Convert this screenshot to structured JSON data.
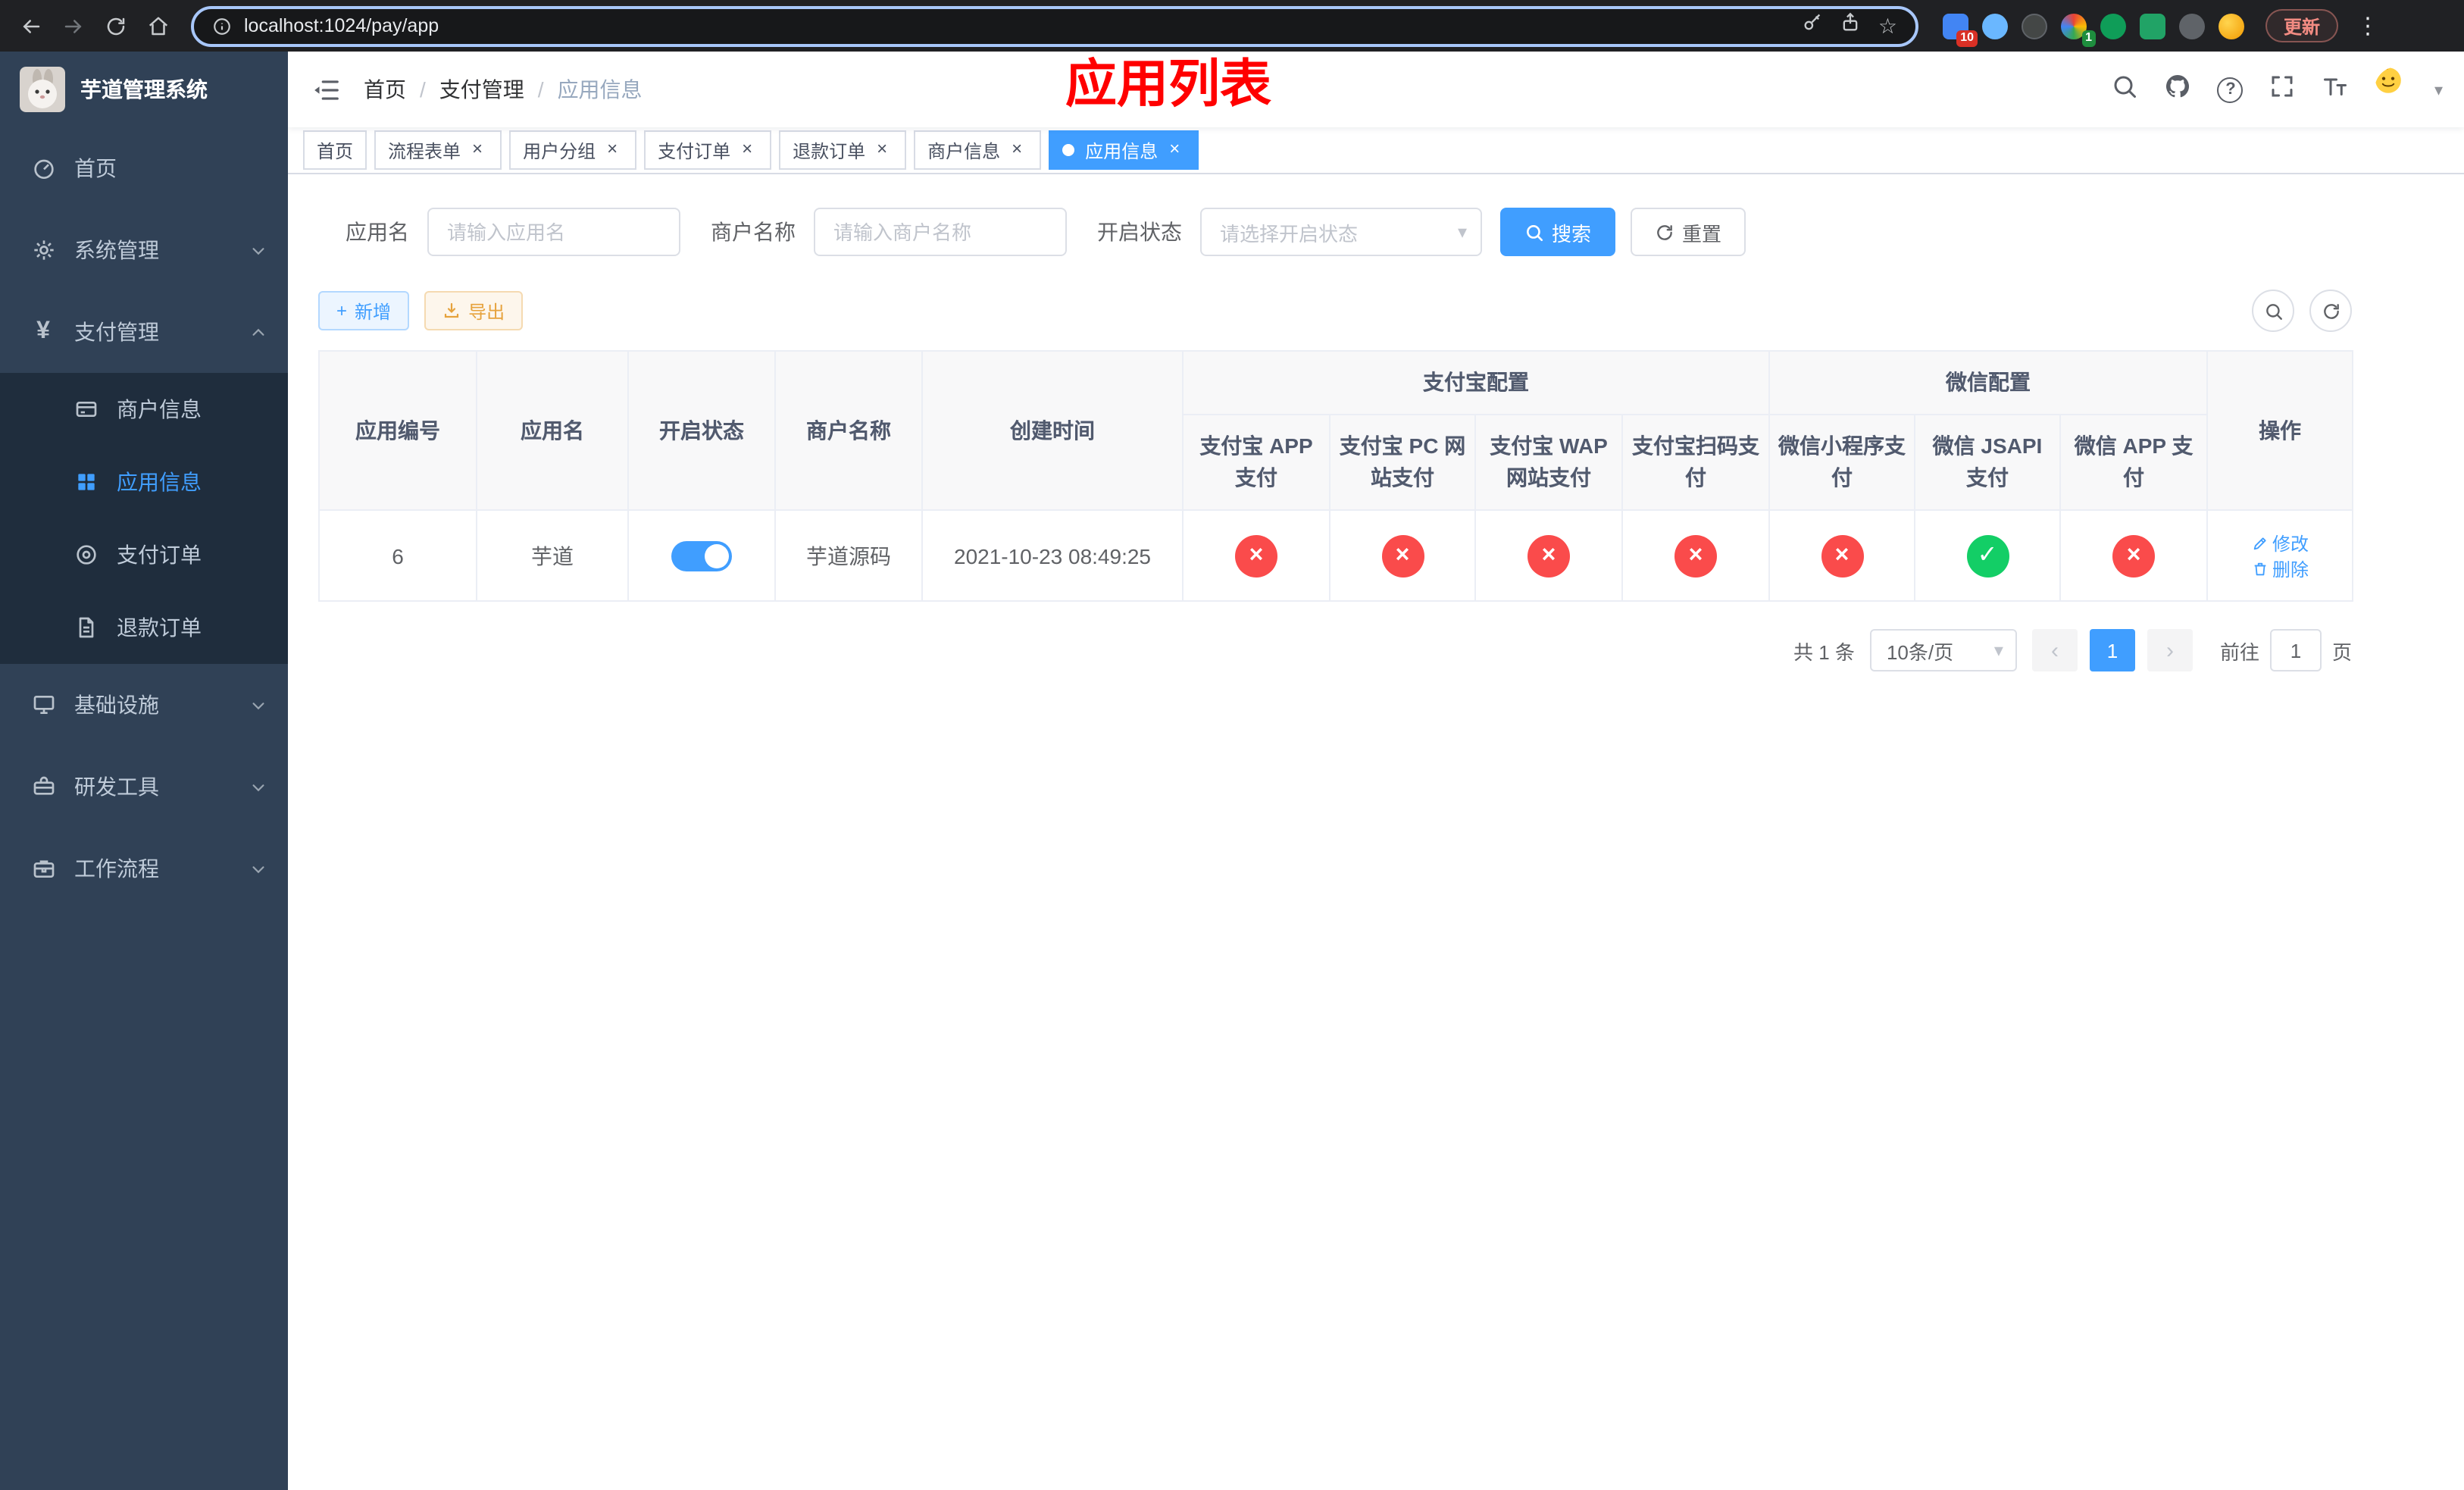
{
  "browser": {
    "url": "localhost:1024/pay/app",
    "update_label": "更新",
    "ext_badge_first": "10",
    "ext_badge_second": "1"
  },
  "icons": {
    "close": "×",
    "star": "☆",
    "kebab": "⋮",
    "caret": "▾",
    "plus": "+",
    "yen": "¥",
    "question": "?",
    "prev": "‹",
    "next": "›"
  },
  "sidebar": {
    "title": "芋道管理系统",
    "home": "首页",
    "system": "系统管理",
    "payment": "支付管理",
    "infra": "基础设施",
    "devtools": "研发工具",
    "workflow": "工作流程",
    "merchant_info": "商户信息",
    "app_info": "应用信息",
    "pay_order": "支付订单",
    "refund_order": "退款订单"
  },
  "header": {
    "breadcrumb": [
      "首页",
      "支付管理",
      "应用信息"
    ],
    "separator": "/",
    "overlay_title": "应用列表"
  },
  "tabs": [
    {
      "label": "首页"
    },
    {
      "label": "流程表单"
    },
    {
      "label": "用户分组"
    },
    {
      "label": "支付订单"
    },
    {
      "label": "退款订单"
    },
    {
      "label": "商户信息"
    },
    {
      "label": "应用信息"
    }
  ],
  "filters": {
    "app_name_label": "应用名",
    "app_name_placeholder": "请输入应用名",
    "merchant_label": "商户名称",
    "merchant_placeholder": "请输入商户名称",
    "status_label": "开启状态",
    "status_placeholder": "请选择开启状态",
    "search_label": "搜索",
    "reset_label": "重置"
  },
  "toolbar": {
    "add_label": "新增",
    "export_label": "导出"
  },
  "table": {
    "group_alipay": "支付宝配置",
    "group_wechat": "微信配置",
    "columns": [
      "应用编号",
      "应用名",
      "开启状态",
      "商户名称",
      "创建时间",
      "支付宝 APP 支付",
      "支付宝 PC 网站支付",
      "支付宝 WAP 网站支付",
      "支付宝扫码支付",
      "微信小程序支付",
      "微信 JSAPI 支付",
      "微信 APP 支付",
      "操作"
    ],
    "row": {
      "id": "6",
      "name": "芋道",
      "enabled": "on",
      "merchant": "芋道源码",
      "created": "2021-10-23 08:49:25",
      "statuses": [
        {
          "state": "fail",
          "glyph": "×"
        },
        {
          "state": "fail",
          "glyph": "×"
        },
        {
          "state": "fail",
          "glyph": "×"
        },
        {
          "state": "fail",
          "glyph": "×"
        },
        {
          "state": "fail",
          "glyph": "×"
        },
        {
          "state": "success",
          "glyph": "✓"
        },
        {
          "state": "fail",
          "glyph": "×"
        }
      ],
      "edit_label": "修改",
      "delete_label": "删除"
    }
  },
  "pagination": {
    "total": "共 1 条",
    "page_size": "10条/页",
    "page": "1",
    "goto_label": "前往",
    "goto_value": "1",
    "goto_unit": "页"
  },
  "colors": {
    "accent": "#409eff",
    "success": "#13ce66",
    "danger": "#fa4b4b",
    "warning_text": "#e6a23c",
    "overlay_red": "#ff0000",
    "sidebar_bg": "#304156",
    "submenu_bg": "#1f2d3d"
  }
}
